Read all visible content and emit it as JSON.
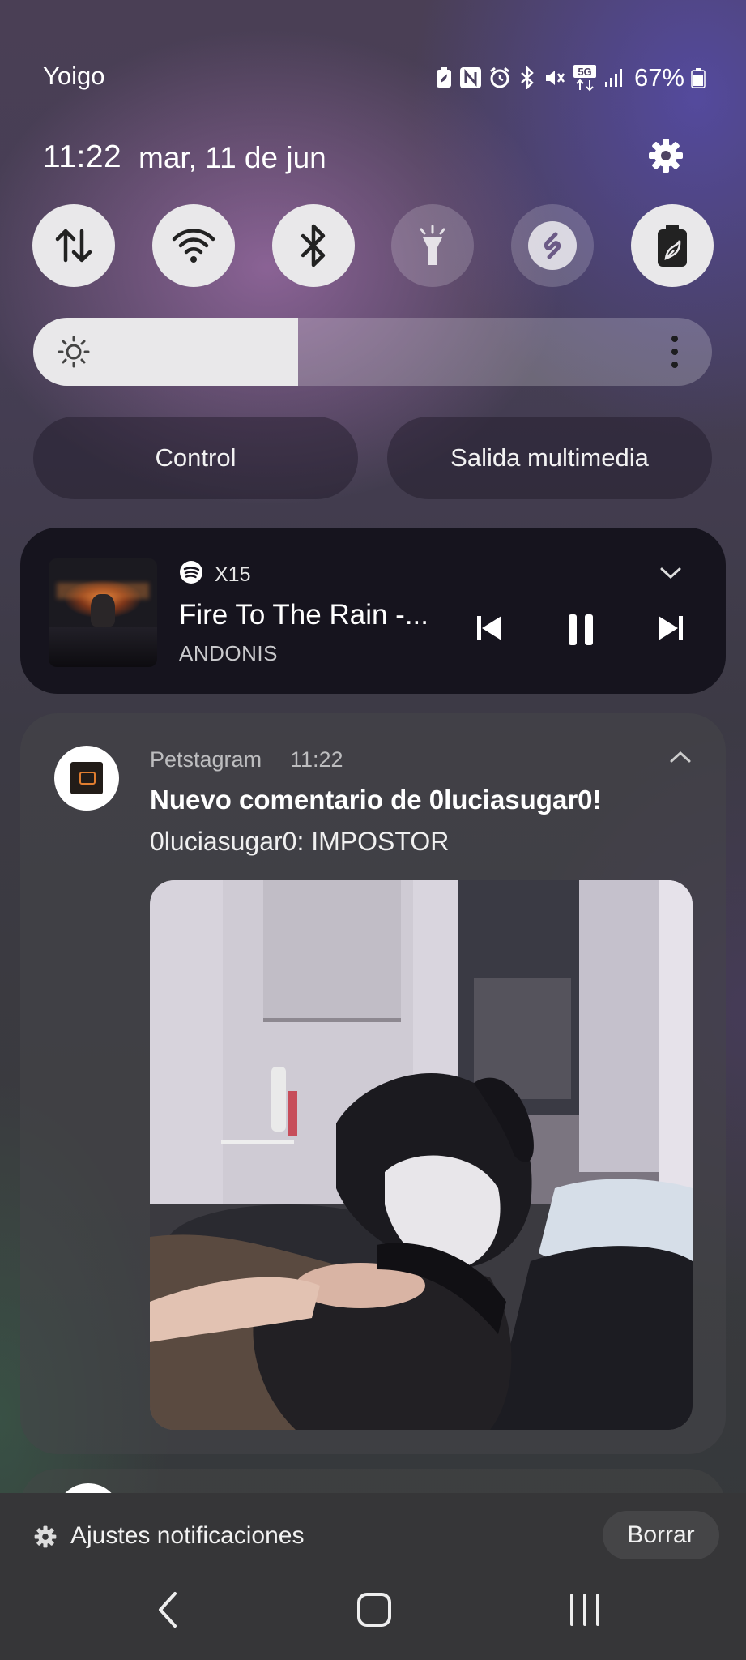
{
  "status_bar": {
    "carrier": "Yoigo",
    "battery_percent": "67%",
    "network": "5G",
    "icons": [
      "battery-saver-icon",
      "nfc-icon",
      "alarm-icon",
      "bluetooth-icon",
      "mute-icon",
      "5g-data-icon",
      "signal-icon",
      "battery-icon"
    ]
  },
  "header": {
    "time": "11:22",
    "date": "mar, 11 de jun"
  },
  "quick_settings": [
    {
      "name": "mobile-data-icon",
      "state": "on"
    },
    {
      "name": "wifi-icon",
      "state": "on"
    },
    {
      "name": "bluetooth-icon",
      "state": "on"
    },
    {
      "name": "flashlight-icon",
      "state": "off"
    },
    {
      "name": "shazam-icon",
      "state": "off"
    },
    {
      "name": "power-saving-icon",
      "state": "on"
    }
  ],
  "brightness": {
    "level": 0.39
  },
  "buttons": {
    "control": "Control",
    "media_output": "Salida multimedia"
  },
  "media_player": {
    "app_label": "X15",
    "song": "Fire To The Rain -...",
    "artist": "ANDONIS",
    "icons": [
      "spotify-icon",
      "chevron-down-icon",
      "previous-icon",
      "pause-icon",
      "next-icon"
    ]
  },
  "notification": {
    "app": "Petstagram",
    "time": "11:22",
    "title": "Nuevo comentario de 0luciasugar0!",
    "body": "0luciasugar0: IMPOSTOR"
  },
  "footer": {
    "settings_label": "Ajustes notificaciones",
    "clear_label": "Borrar"
  },
  "colors": {
    "tile_on": "#e9e8ea",
    "media_bg": "#16141e",
    "spotify": "#ffffff"
  }
}
